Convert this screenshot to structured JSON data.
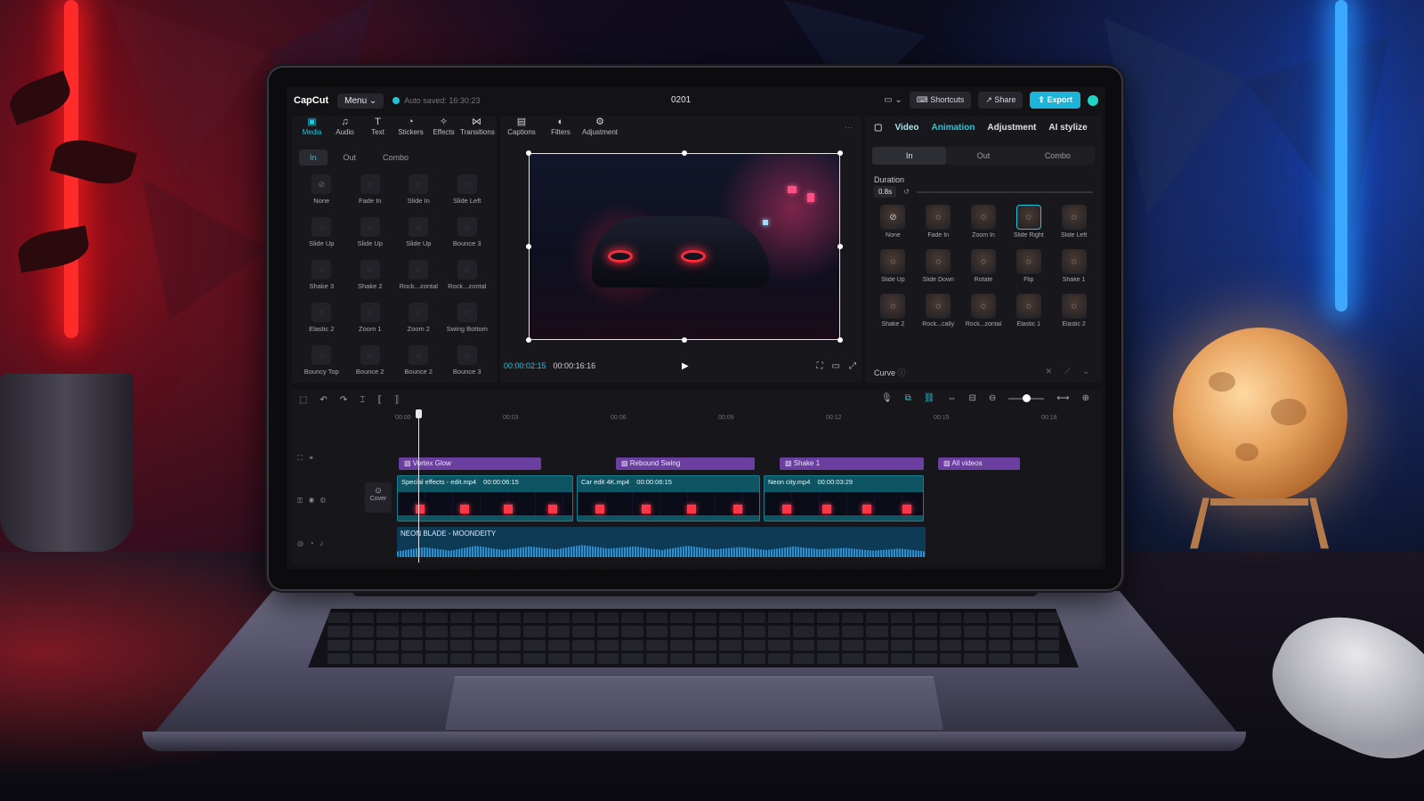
{
  "app": {
    "logo": "CapCut",
    "menu_label": "Menu",
    "autosave": "Auto saved: 16:30:23",
    "project_name": "0201",
    "shortcuts_label": "Shortcuts",
    "share_label": "Share",
    "export_label": "Export"
  },
  "left_panel": {
    "tools": [
      {
        "label": "Media",
        "icon": "media-icon"
      },
      {
        "label": "Audio",
        "icon": "audio-icon"
      },
      {
        "label": "Text",
        "icon": "text-icon"
      },
      {
        "label": "Stickers",
        "icon": "stickers-icon"
      },
      {
        "label": "Effects",
        "icon": "effects-icon"
      },
      {
        "label": "Transitions",
        "icon": "transitions-icon"
      }
    ],
    "subtabs": [
      "In",
      "Out",
      "Combo"
    ],
    "animations": [
      "None",
      "Fade In",
      "Slide In",
      "Slide Left",
      "Slide Up",
      "Slide Up",
      "Slide Up",
      "Bounce 3",
      "Shake 3",
      "Shake 2",
      "Rock...zontal",
      "Rock...zontal",
      "Elastic 2",
      "Zoom 1",
      "Zoom 2",
      "Swing Bottom",
      "Bouncy Top",
      "Bounce 2",
      "Bounce 2",
      "Bounce 3"
    ]
  },
  "preview": {
    "tools": [
      {
        "label": "Captions",
        "icon": "captions-icon"
      },
      {
        "label": "Filters",
        "icon": "filters-icon"
      },
      {
        "label": "Adjustment",
        "icon": "adjustment-icon"
      }
    ],
    "current_time": "00:00:02:15",
    "total_time": "00:00:16:16"
  },
  "right_panel": {
    "tabs": [
      "Video",
      "Animation",
      "Adjustment",
      "AI stylize"
    ],
    "segments": [
      "In",
      "Out",
      "Combo"
    ],
    "duration_label": "Duration",
    "duration_value": "0.8s",
    "animations": [
      "None",
      "Fade In",
      "Zoom In",
      "Slide Right",
      "Slide Left",
      "Slide Up",
      "Slide Down",
      "Rotate",
      "Flip",
      "Shake 1",
      "Shake 2",
      "Rock...cally",
      "Rock...zontal",
      "Elastic 1",
      "Elastic 2"
    ],
    "curve_label": "Curve"
  },
  "timeline": {
    "ruler": [
      "00:00",
      "00:03",
      "00:06",
      "00:09",
      "00:12",
      "00:15",
      "00:18"
    ],
    "cover_label": "Cover",
    "effects": [
      "Vortex Glow",
      "Rebound Swing",
      "Shake 1",
      "All videos"
    ],
    "videos": [
      {
        "name": "Special effects - edit.mp4",
        "duration": "00:00:06:15"
      },
      {
        "name": "Car edit 4K.mp4",
        "duration": "00:00:06:15"
      },
      {
        "name": "Neon city.mp4",
        "duration": "00:00:03:29"
      }
    ],
    "audio": "NEON BLADE - MOONDEITY"
  },
  "colors": {
    "accent": "#22c6dd",
    "effect_clip": "#6a3f9f",
    "video_clip": "#0f5462",
    "audio_clip": "#0d3b56"
  }
}
